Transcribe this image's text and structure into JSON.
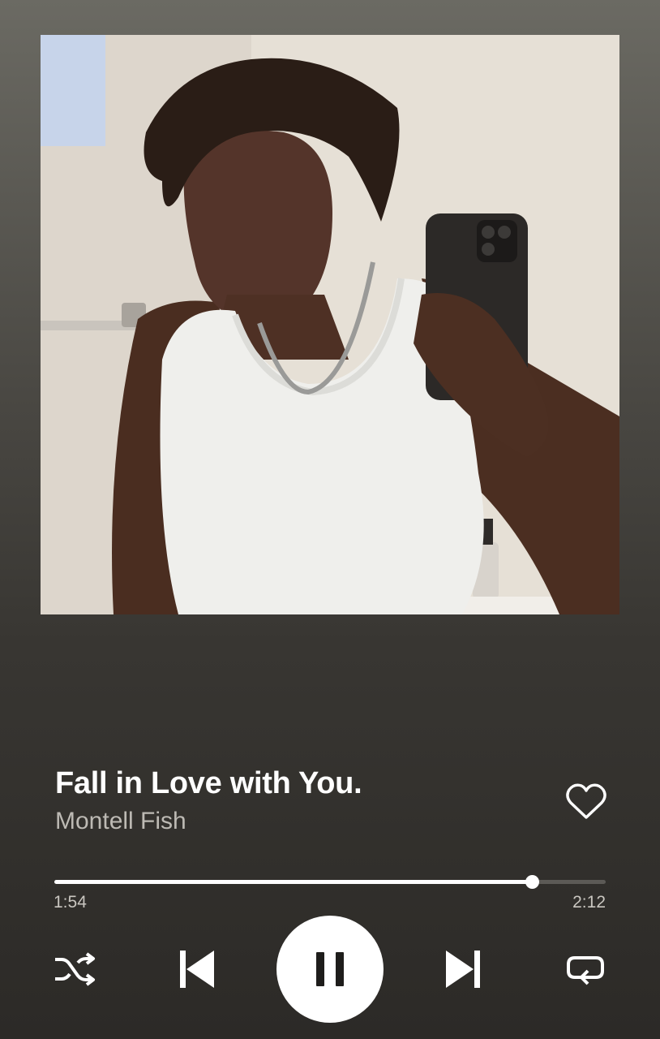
{
  "track": {
    "title": "Fall in Love with You.",
    "artist": "Montell Fish",
    "liked": false
  },
  "playback": {
    "elapsed": "1:54",
    "total": "2:12",
    "progress_fraction": 0.866,
    "is_playing": true
  },
  "controls": {
    "shuffle_icon": "shuffle-icon",
    "previous_icon": "skip-previous-icon",
    "play_pause_icon": "pause-icon",
    "next_icon": "skip-next-icon",
    "repeat_icon": "repeat-icon",
    "like_icon": "heart-outline-icon"
  },
  "colors": {
    "background_top": "#6b6a63",
    "background_bottom": "#2c2a27",
    "text_primary": "#ffffff",
    "text_secondary": "#bdbab4",
    "progress_track": "#5c5a56"
  }
}
